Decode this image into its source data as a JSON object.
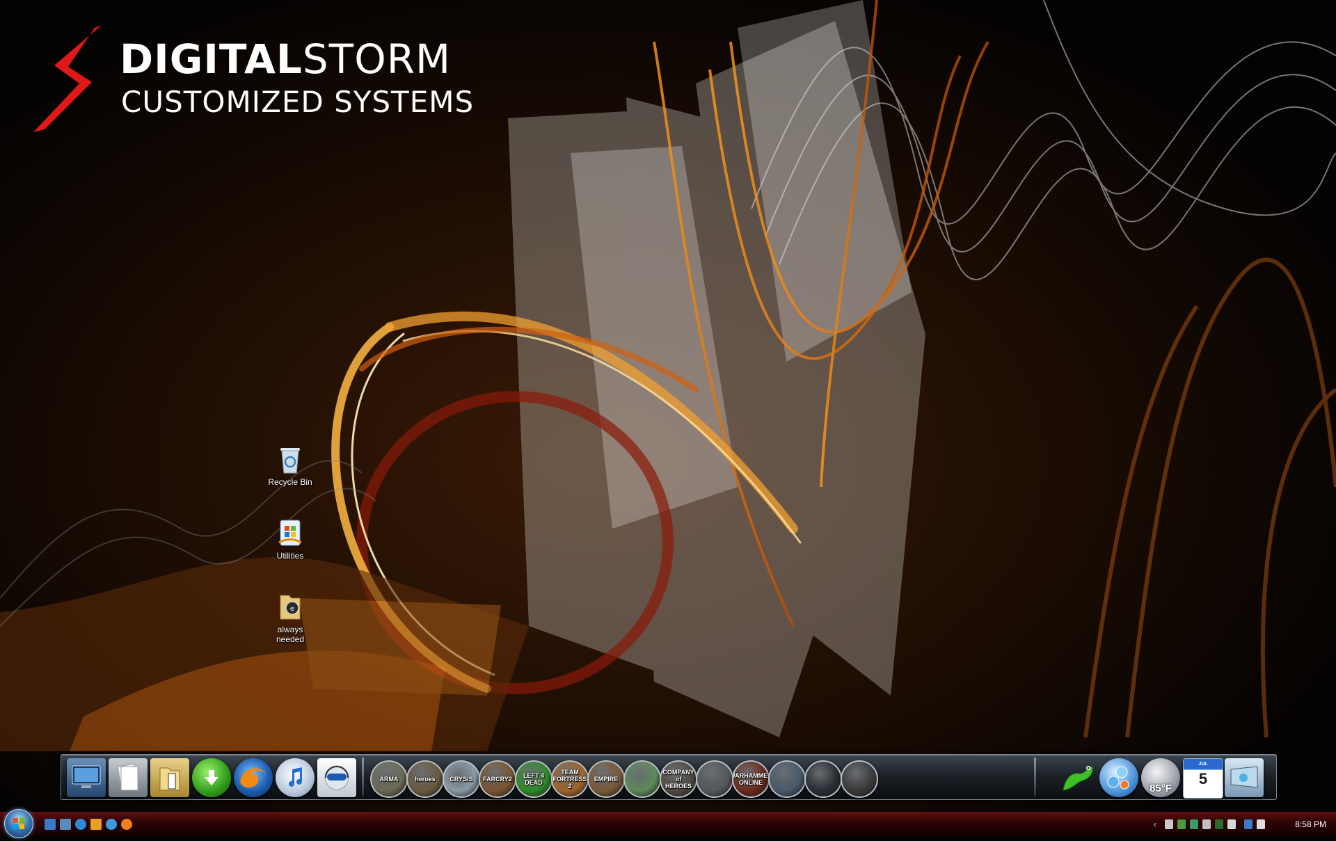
{
  "brand": {
    "name_strong": "DIGITAL",
    "name_light": "STORM",
    "tagline": "CUSTOMIZED SYSTEMS",
    "accent_color": "#e01818"
  },
  "desktop_icons": [
    {
      "label": "Recycle Bin",
      "icon": "recycle-bin-icon"
    },
    {
      "label": "Utilities",
      "icon": "utilities-icon"
    },
    {
      "label": "always\nneeded",
      "icon": "folder-icon"
    }
  ],
  "dock": {
    "system_items": [
      {
        "icon": "computer-icon"
      },
      {
        "icon": "documents-icon"
      },
      {
        "icon": "folder-icon"
      },
      {
        "icon": "download-icon"
      },
      {
        "icon": "firefox-icon"
      },
      {
        "icon": "itunes-icon"
      },
      {
        "icon": "messenger-icon"
      }
    ],
    "games": [
      {
        "label": "ARMA",
        "color": "#6b6b55"
      },
      {
        "label": "heroes",
        "color": "#6a5a40"
      },
      {
        "label": "CRYSIS",
        "color": "#8a9aa6"
      },
      {
        "label": "FARCRY2",
        "color": "#7a5530"
      },
      {
        "label": "LEFT 4 DEAD",
        "color": "#2f8a2a"
      },
      {
        "label": "TEAM FORTRESS 2",
        "color": "#a0642a"
      },
      {
        "label": "EMPIRE",
        "color": "#7b5a3a"
      },
      {
        "label": "",
        "color": "#5d8a5a"
      },
      {
        "label": "COMPANY of HEROES",
        "color": "#504a40"
      },
      {
        "label": "",
        "color": "#55585a"
      },
      {
        "label": "WARHAMMER ONLINE",
        "color": "#6a2a1a"
      },
      {
        "label": "",
        "color": "#4a5a6a"
      },
      {
        "label": "",
        "color": "#2a2e34"
      },
      {
        "label": "",
        "color": "#3a3a3a"
      }
    ],
    "utility_items": [
      {
        "icon": "gecko-icon"
      },
      {
        "icon": "bubbles-settings-icon"
      },
      {
        "icon": "weather-moon-icon"
      },
      {
        "icon": "calendar-icon"
      },
      {
        "icon": "display-icon"
      }
    ],
    "weather_temp": "85°F",
    "calendar_month": "JUL",
    "calendar_day": "5"
  },
  "taskbar": {
    "quick_launch": [
      {
        "icon": "show-desktop-icon"
      },
      {
        "icon": "switch-windows-icon"
      },
      {
        "icon": "internet-explorer-icon"
      },
      {
        "icon": "media-player-icon"
      },
      {
        "icon": "search-icon"
      },
      {
        "icon": "firefox-icon"
      }
    ],
    "tray_time": "8:58 PM"
  }
}
